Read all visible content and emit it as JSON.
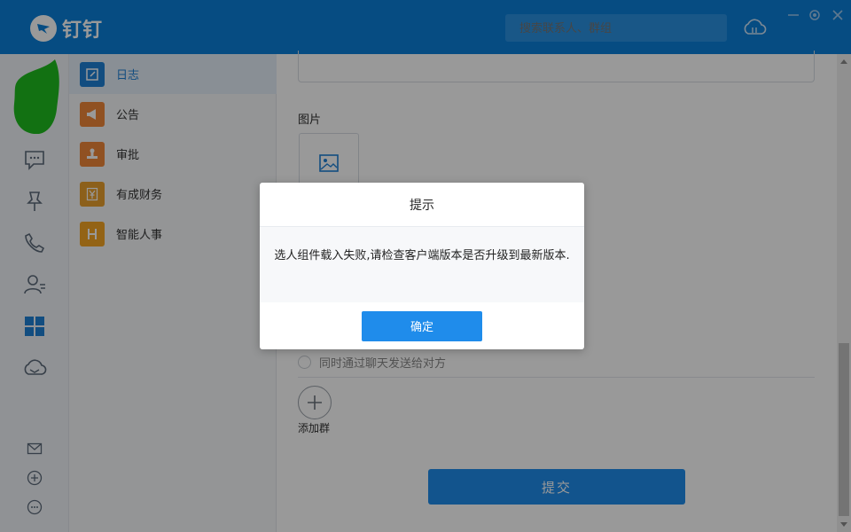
{
  "app": {
    "name": "钉钉"
  },
  "search": {
    "placeholder": "搜索联系人、群组"
  },
  "apps": [
    {
      "label": "日志",
      "icon": "journal-icon",
      "color": "#1f80d6"
    },
    {
      "label": "公告",
      "icon": "megaphone-icon",
      "color": "#f0883a"
    },
    {
      "label": "审批",
      "icon": "stamp-icon",
      "color": "#f0883a"
    },
    {
      "label": "有成财务",
      "icon": "yen-icon",
      "color": "#e9a12e"
    },
    {
      "label": "智能人事",
      "icon": "hr-icon",
      "color": "#f5a623"
    }
  ],
  "form": {
    "images_label": "图片",
    "sync_chat_label": "同时通过聊天发送给对方",
    "add_group_label": "添加群",
    "submit_label": "提交"
  },
  "dialog": {
    "title": "提示",
    "message": "选人组件载入失败,请检查客户端版本是否升级到最新版本.",
    "ok_label": "确定"
  },
  "colors": {
    "brand": "#0a7fd9",
    "primary_button": "#1f8ceb"
  }
}
